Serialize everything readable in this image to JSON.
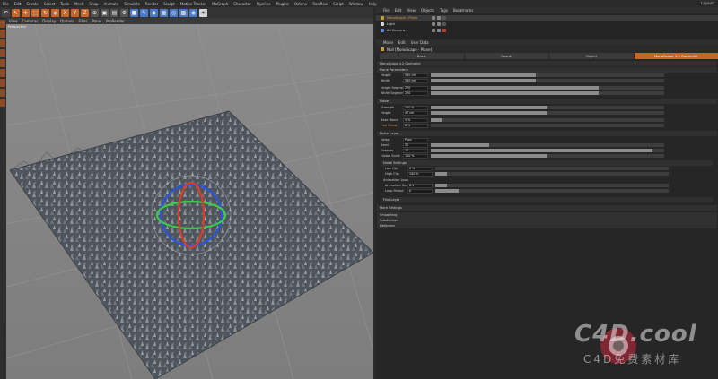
{
  "menubar": {
    "items": [
      "File",
      "Edit",
      "Create",
      "Select",
      "Tools",
      "Mesh",
      "Snap",
      "Animate",
      "Simulate",
      "Render",
      "Sculpt",
      "Motion Tracker",
      "MoGraph",
      "Character",
      "Pipeline",
      "Plugins",
      "Octane",
      "Realflow",
      "Script",
      "Window",
      "Help"
    ],
    "layout_label": "Layout:"
  },
  "viewport": {
    "menu": [
      "View",
      "Cameras",
      "Display",
      "Options",
      "Filter",
      "Panel",
      "ProRender"
    ],
    "label": "Perspective"
  },
  "object_manager": {
    "menu": [
      "File",
      "Edit",
      "View",
      "Objects",
      "Tags",
      "Bookmarks"
    ],
    "objects": [
      {
        "name": "MonoScape - Plane",
        "icon_color": "#c99a3a",
        "selected": true
      },
      {
        "name": "Light",
        "icon_color": "#d9d9d9",
        "selected": false
      },
      {
        "name": "AS Camera.1",
        "icon_color": "#5a8ad6",
        "selected": false
      }
    ]
  },
  "attributes": {
    "menu": [
      "Mode",
      "Edit",
      "User Data"
    ],
    "title": "Null [MonoScape - Plane]",
    "tabs": [
      "Basic",
      "Coord.",
      "Object",
      "MonoScape 1.2 Controller"
    ],
    "active_tab": 3,
    "controller_header": "MonoScape v.2 Controller",
    "sections": {
      "plane_params": "Plane Parameters",
      "noise": "Noise",
      "noise_layer": "Noise Layer",
      "noise_settings": "Noise Settings",
      "animation_loop": "Animation Loop",
      "fine_layer": "Fine Layer",
      "more_settings": "More Settings",
      "smoothing": "Smoothing",
      "subdivision": "Subdivision",
      "deformer": "Deformer"
    },
    "params": [
      {
        "label": "Height",
        "value": "500 cm",
        "level": 0.45
      },
      {
        "label": "Width",
        "value": "500 cm",
        "level": 0.45
      },
      {
        "label": "Height Segments",
        "value": "270",
        "level": 0.72
      },
      {
        "label": "Width Segments",
        "value": "270",
        "level": 0.72
      },
      {
        "label": "Strength",
        "value": "100 %",
        "level": 0.5
      },
      {
        "label": "Height",
        "value": "47 cm",
        "level": 0.5
      },
      {
        "label": "Base Blend",
        "value": "5 %",
        "level": 0.05
      },
      {
        "label": "Fine Blend",
        "value": "0 %",
        "level": 0.0
      },
      {
        "label": "Noise",
        "value": "Poxo",
        "level": null
      },
      {
        "label": "Seed",
        "value": "32",
        "level": 0.25
      },
      {
        "label": "Octaves",
        "value": "10",
        "level": 0.95
      },
      {
        "label": "Global Scale",
        "value": "100 %",
        "level": 0.5
      },
      {
        "label": "Low Clip",
        "value": "0 %",
        "level": 0.0
      },
      {
        "label": "High Clip",
        "value": "100 %",
        "level": 0.05
      },
      {
        "label": "Animation Speed",
        "value": "0.1",
        "level": 0.05
      },
      {
        "label": "Loop Period",
        "value": "0",
        "level": 0.1
      }
    ]
  },
  "watermark": {
    "main": "C4D.cool",
    "sub": "C4D免费素材库"
  },
  "colors": {
    "accent": "#c8642a",
    "ui_bg": "#262626",
    "viewport_bg": "#8a8a8a",
    "terrain": "#5a6068",
    "gizmo_x": "#e03a2a",
    "gizmo_y": "#3acb4a",
    "gizmo_z": "#2a55e0"
  }
}
